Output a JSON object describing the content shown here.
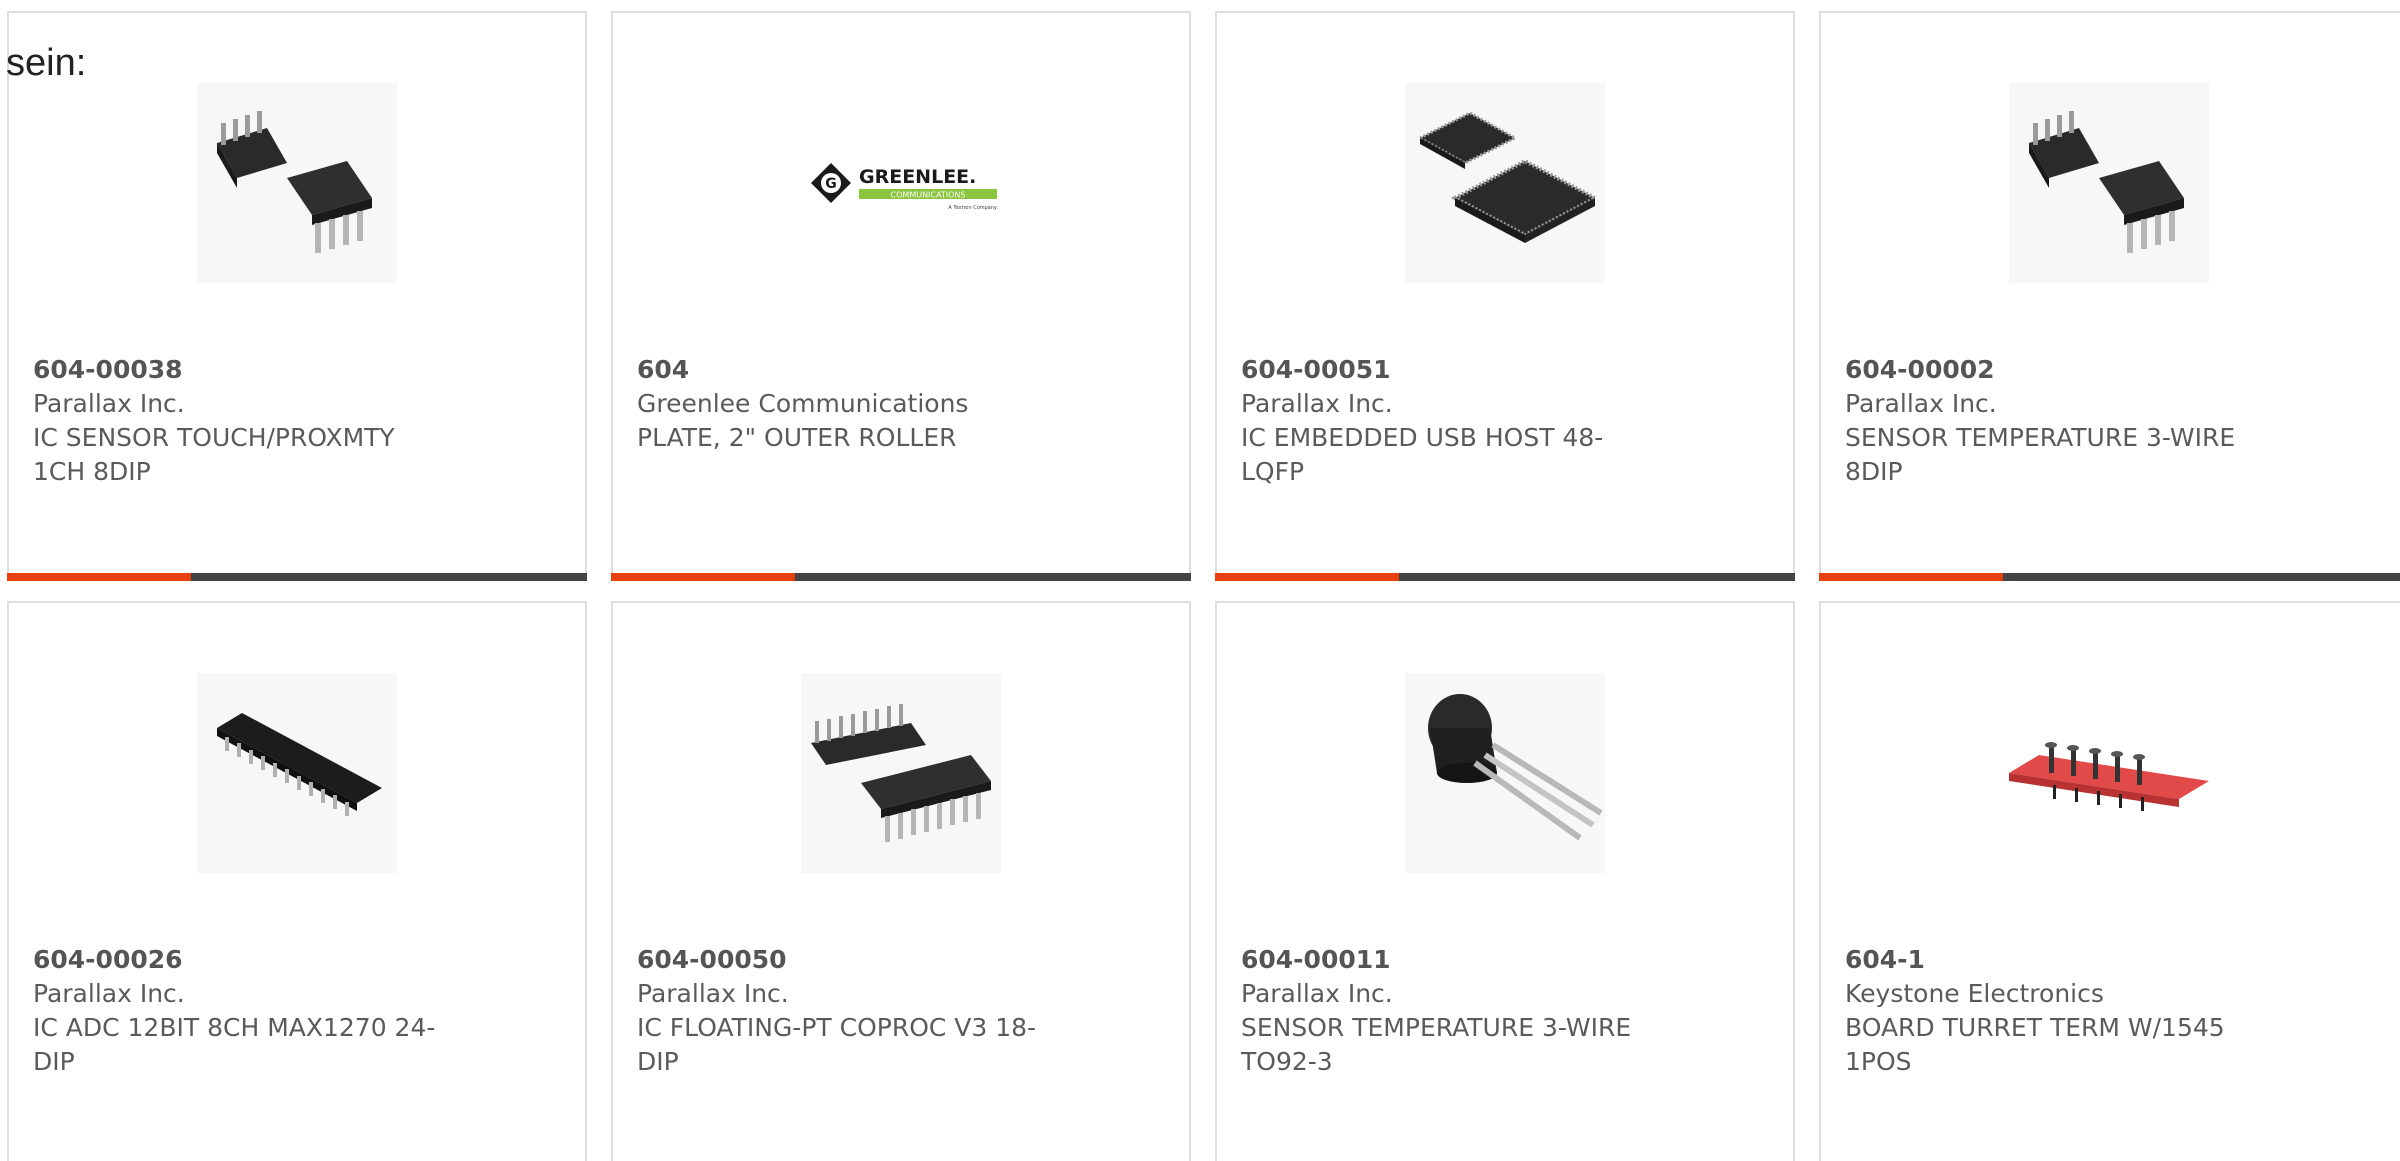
{
  "lead_text": "sein:",
  "colors": {
    "accent": "#e8400c",
    "bar": "#444444",
    "border": "#dedede",
    "text": "#5a5a5a"
  },
  "products": [
    {
      "part": "604-00038",
      "maker": "Parallax Inc.",
      "desc1": "IC SENSOR TOUCH/PROXMTY",
      "desc2": "1CH 8DIP",
      "image": "dip-8-icon"
    },
    {
      "part": "604",
      "maker": "Greenlee Communications",
      "desc1": "PLATE, 2\" OUTER ROLLER",
      "desc2": "",
      "image": "greenlee-logo",
      "logo_text": "GREENLEE.",
      "logo_sub": "COMMUNICATIONS",
      "logo_small": "A Textron Company"
    },
    {
      "part": "604-00051",
      "maker": "Parallax Inc.",
      "desc1": "IC EMBEDDED USB HOST 48-",
      "desc2": "LQFP",
      "image": "lqfp-icon"
    },
    {
      "part": "604-00002",
      "maker": "Parallax Inc.",
      "desc1": "SENSOR TEMPERATURE 3-WIRE",
      "desc2": "8DIP",
      "image": "dip-8-icon"
    },
    {
      "part": "604-00026",
      "maker": "Parallax Inc.",
      "desc1": "IC ADC 12BIT 8CH MAX1270 24-",
      "desc2": "DIP",
      "image": "dip-24-icon"
    },
    {
      "part": "604-00050",
      "maker": "Parallax Inc.",
      "desc1": "IC FLOATING-PT COPROC V3 18-",
      "desc2": "DIP",
      "image": "dip-18-icon"
    },
    {
      "part": "604-00011",
      "maker": "Parallax Inc.",
      "desc1": "SENSOR TEMPERATURE 3-WIRE",
      "desc2": "TO92-3",
      "image": "to92-icon"
    },
    {
      "part": "604-1",
      "maker": "Keystone Electronics",
      "desc1": "BOARD TURRET TERM W/1545",
      "desc2": "1POS",
      "image": "turret-board-icon"
    }
  ]
}
